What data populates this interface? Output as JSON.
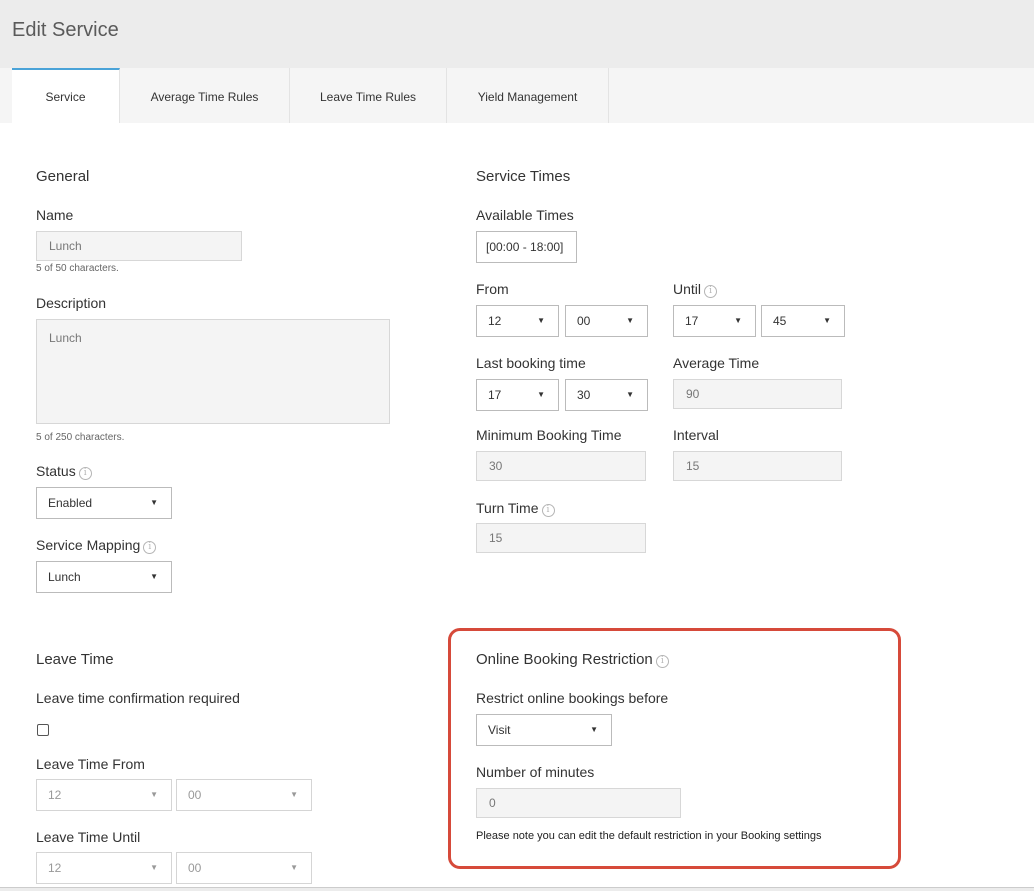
{
  "header": {
    "title": "Edit Service"
  },
  "tabs": [
    {
      "label": "Service",
      "active": true
    },
    {
      "label": "Average Time Rules",
      "active": false
    },
    {
      "label": "Leave Time Rules",
      "active": false
    },
    {
      "label": "Yield Management",
      "active": false
    }
  ],
  "general": {
    "heading": "General",
    "name_label": "Name",
    "name_value": "Lunch",
    "name_count": "5 of 50 characters.",
    "description_label": "Description",
    "description_value": "Lunch",
    "description_count": "5 of 250 characters.",
    "status_label": "Status",
    "status_value": "Enabled",
    "mapping_label": "Service Mapping",
    "mapping_value": "Lunch"
  },
  "service_times": {
    "heading": "Service Times",
    "available_label": "Available Times",
    "available_value": "[00:00 - 18:00]",
    "from_label": "From",
    "from_hour": "12",
    "from_minute": "00",
    "until_label": "Until",
    "until_hour": "17",
    "until_minute": "45",
    "last_booking_label": "Last booking time",
    "last_booking_hour": "17",
    "last_booking_minute": "30",
    "average_time_label": "Average Time",
    "average_time_value": "90",
    "min_booking_label": "Minimum Booking Time",
    "min_booking_value": "30",
    "interval_label": "Interval",
    "interval_value": "15",
    "turn_time_label": "Turn Time",
    "turn_time_value": "15"
  },
  "leave_time": {
    "heading": "Leave Time",
    "confirmation_label": "Leave time confirmation required",
    "confirmation_checked": false,
    "from_label": "Leave Time From",
    "from_hour": "12",
    "from_minute": "00",
    "until_label": "Leave Time Until",
    "until_hour": "12",
    "until_minute": "00"
  },
  "online_restriction": {
    "heading": "Online Booking Restriction",
    "restrict_label": "Restrict online bookings before",
    "restrict_value": "Visit",
    "minutes_label": "Number of minutes",
    "minutes_value": "0",
    "note": "Please note you can edit the default restriction in your Booking settings"
  },
  "icons": {
    "info": "info-circle-icon",
    "caret": "caret-down-icon"
  },
  "colors": {
    "active_tab": "#4aa3d8",
    "highlight": "#d64a3a"
  },
  "glyphs": {
    "info": "i",
    "caret": "▼"
  }
}
